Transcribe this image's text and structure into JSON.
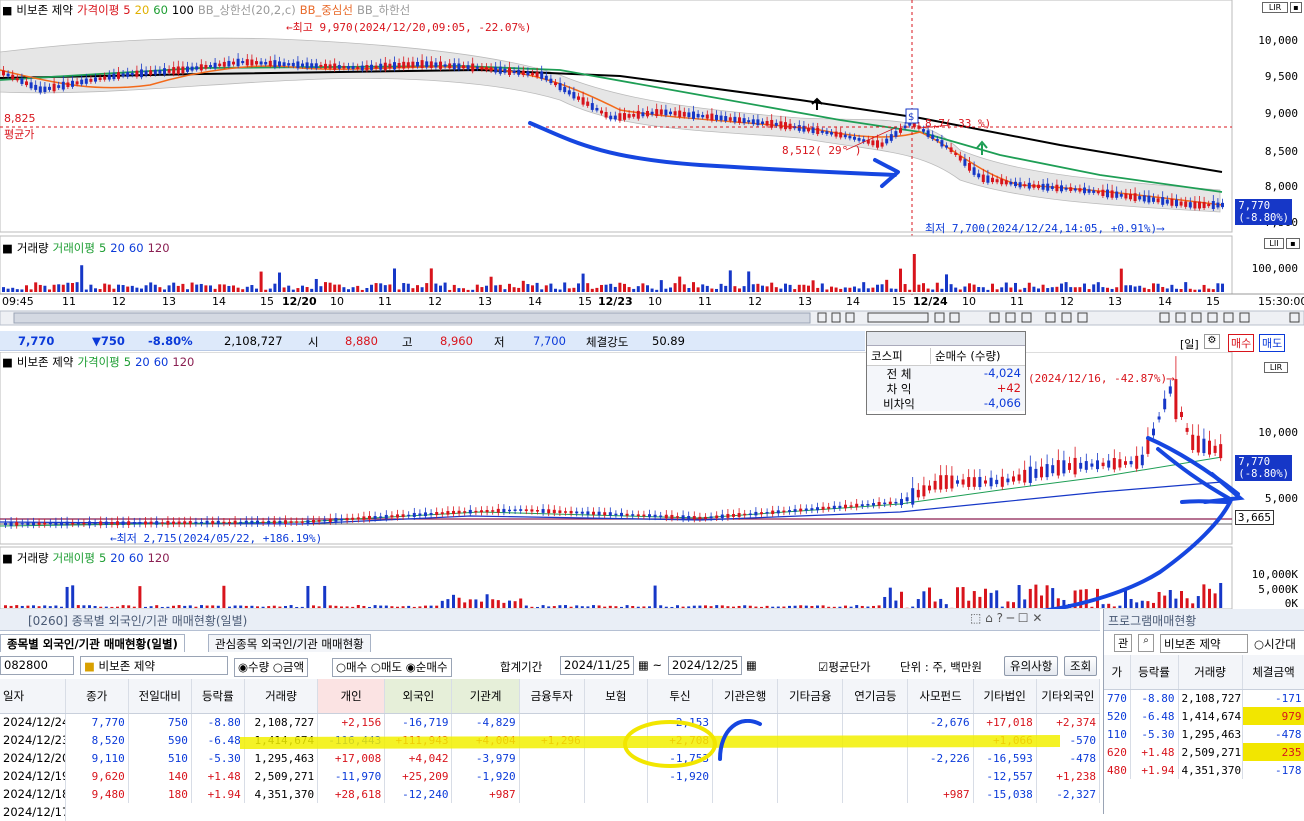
{
  "top_chart": {
    "legend": {
      "name": "비보존 제약",
      "ma_label": "가격이평",
      "ma5": "5",
      "ma20": "20",
      "ma60": "60",
      "ma100": "100",
      "bb_upper": "BB_상한선(20,2,c)",
      "bb_mid": "BB_중심선",
      "bb_lower": "BB_하한선"
    },
    "high_note": "←최고 9,970(2024/12/20,09:05, -22.07%)",
    "low_note": "최저 7,700(2024/12/24,14:05, +0.91%)⟶",
    "avg_price": "8,825",
    "avg_label": "평균가",
    "point_label": "8,512( 29° )",
    "point_label2": "8,7( 33 %)",
    "y_ticks": [
      "10,000",
      "9,500",
      "9,000",
      "8,500",
      "8,000",
      "7,500"
    ],
    "price_box": [
      "7,770",
      "(-8.80%)"
    ],
    "volume_legend": {
      "name": "거래량",
      "ma_label": "거래이평",
      "ma5": "5",
      "ma20": "20",
      "ma60": "60",
      "ma120": "120"
    },
    "volume_tick": "100,000",
    "x_ticks": [
      "09:45",
      "11",
      "12",
      "13",
      "14",
      "15",
      "12/20",
      "10",
      "11",
      "12",
      "13",
      "14",
      "15",
      "12/23",
      "10",
      "11",
      "12",
      "13",
      "14",
      "15",
      "12/24",
      "10",
      "11",
      "12",
      "13",
      "14",
      "15",
      "15:30:00"
    ]
  },
  "info_bar": {
    "price": "7,770",
    "change": "▼750",
    "rate": "-8.80%",
    "volume": "2,108,727",
    "open_label": "시",
    "open": "8,880",
    "high_label": "고",
    "high": "8,960",
    "low_label": "저",
    "low": "7,700",
    "strength_label": "체결강도",
    "strength": "50.89"
  },
  "popup": {
    "market": "코스피",
    "type": "순매수 (수량)",
    "rows": [
      {
        "label": "전 체",
        "value": "-4,024"
      },
      {
        "label": "차 익",
        "value": "+42"
      },
      {
        "label": "비차익",
        "value": "-4,066"
      }
    ]
  },
  "mid_chart": {
    "legend": {
      "name": "비보존 제약",
      "ma_label": "가격이평",
      "ma5": "5",
      "ma20": "20",
      "ma60": "60",
      "ma120": "120"
    },
    "period": "[일]",
    "buy": "매수",
    "sell": "매도",
    "high_note": "(2024/12/16, -42.87%)⟶",
    "low_note": "←최저 2,715(2024/05/22, +186.19%)",
    "y_ticks": [
      "10,000",
      "5,000"
    ],
    "price_box": [
      "7,770",
      "(-8.80%)"
    ],
    "level_box": "3,665",
    "volume_legend": {
      "name": "거래량",
      "ma_label": "거래이평",
      "ma5": "5",
      "ma20": "20",
      "ma60": "60",
      "ma120": "120"
    },
    "volume_ticks": [
      "10,000K",
      "5,000K",
      "0K"
    ]
  },
  "panel": {
    "title": "[0260] 종목별 외국인/기관 매매현황(일별)",
    "tabs": [
      "종목별 외국인/기관 매매현황(일별)",
      "관심종목 외국인/기관 매매현황"
    ],
    "code": "082800",
    "stock_name": "비보존 제약",
    "radios1": [
      "수량",
      "금액"
    ],
    "radios2": [
      "매수",
      "매도",
      "순매수"
    ],
    "period_label": "합계기간",
    "date_from": "2024/11/25",
    "date_to": "2024/12/25",
    "avg_check": "평균단가",
    "unit": "단위 : 주, 백만원",
    "notice_btn": "유의사항",
    "query_btn": "조회",
    "headers": [
      "일자",
      "종가",
      "전일대비",
      "등락률",
      "거래량",
      "개인",
      "외국인",
      "기관계",
      "금융투자",
      "보험",
      "투신",
      "기관은행",
      "기타금융",
      "연기금등",
      "사모펀드",
      "기타법인",
      "기타외국인"
    ],
    "rows": [
      [
        "2024/12/24",
        "7,770",
        "750",
        "-8.80",
        "2,108,727",
        "+2,156",
        "-16,719",
        "-4,829",
        "",
        "",
        "-2,153",
        "",
        "",
        "",
        "-2,676",
        "+17,018",
        "+2,374"
      ],
      [
        "2024/12/23",
        "8,520",
        "590",
        "-6.48",
        "1,414,674",
        "-116,443",
        "+111,943",
        "+4,004",
        "+1,296",
        "",
        "+2,708",
        "",
        "",
        "",
        "",
        "+1,066",
        "-570"
      ],
      [
        "2024/12/20",
        "9,110",
        "510",
        "-5.30",
        "1,295,463",
        "+17,008",
        "+4,042",
        "-3,979",
        "",
        "",
        "-1,753",
        "",
        "",
        "",
        "-2,226",
        "-16,593",
        "-478"
      ],
      [
        "2024/12/19",
        "9,620",
        "140",
        "+1.48",
        "2,509,271",
        "-11,970",
        "+25,209",
        "-1,920",
        "",
        "",
        "-1,920",
        "",
        "",
        "",
        "",
        "-12,557",
        "+1,238"
      ],
      [
        "2024/12/18",
        "9,480",
        "180",
        "+1.94",
        "4,351,370",
        "+28,618",
        "-12,240",
        "+987",
        "",
        "",
        "",
        "",
        "",
        "",
        "+987",
        "-15,038",
        "-2,327"
      ]
    ],
    "partial_row": "2024/12/17"
  },
  "right_panel": {
    "title": "프로그램매매현황",
    "tag": "관",
    "stock_name": "비보존 제약",
    "radio": "시간대",
    "headers": [
      "가",
      "등락률",
      "거래량",
      "체결금액"
    ],
    "rows": [
      [
        "770",
        "-8.80",
        "2,108,727",
        "-171"
      ],
      [
        "520",
        "-6.48",
        "1,414,674",
        "979"
      ],
      [
        "110",
        "-5.30",
        "1,295,463",
        "-478"
      ],
      [
        "620",
        "+1.48",
        "2,509,271",
        "235"
      ],
      [
        "480",
        "+1.94",
        "4,351,370",
        "-178"
      ]
    ]
  },
  "colors": {
    "up": "#d8141c",
    "down": "#0b3ad9",
    "ma5": "#f36a1a",
    "ma20": "#1e9e55",
    "ma60": "#000000",
    "annotation": "#1646e0",
    "highlight": "#f2f000"
  }
}
